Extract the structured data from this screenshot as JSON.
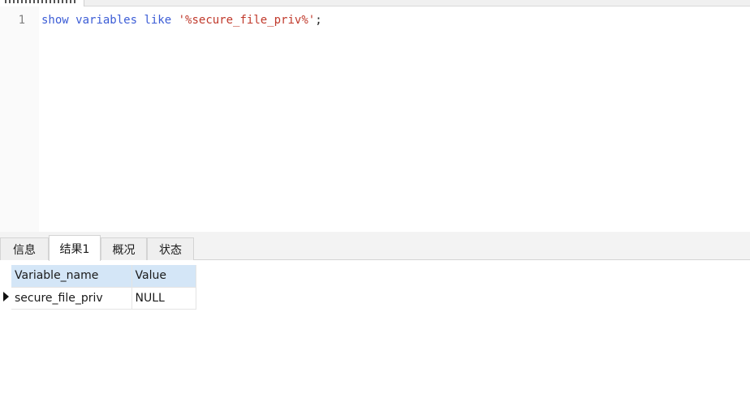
{
  "editor": {
    "line_number": "1",
    "code": {
      "keyword1": "show",
      "keyword2": "variables",
      "keyword3": "like",
      "string": "'%secure_file_priv%'",
      "terminator": ";"
    }
  },
  "result_tabs": [
    {
      "label": "信息"
    },
    {
      "label": "结果1"
    },
    {
      "label": "概况"
    },
    {
      "label": "状态"
    }
  ],
  "active_tab": "结果1",
  "grid": {
    "columns": [
      "Variable_name",
      "Value"
    ],
    "rows": [
      [
        "secure_file_priv",
        "NULL"
      ]
    ]
  },
  "colors": {
    "keyword": "#3c5dd6",
    "string": "#c0392b",
    "header_bg": "#d4e6f7"
  }
}
